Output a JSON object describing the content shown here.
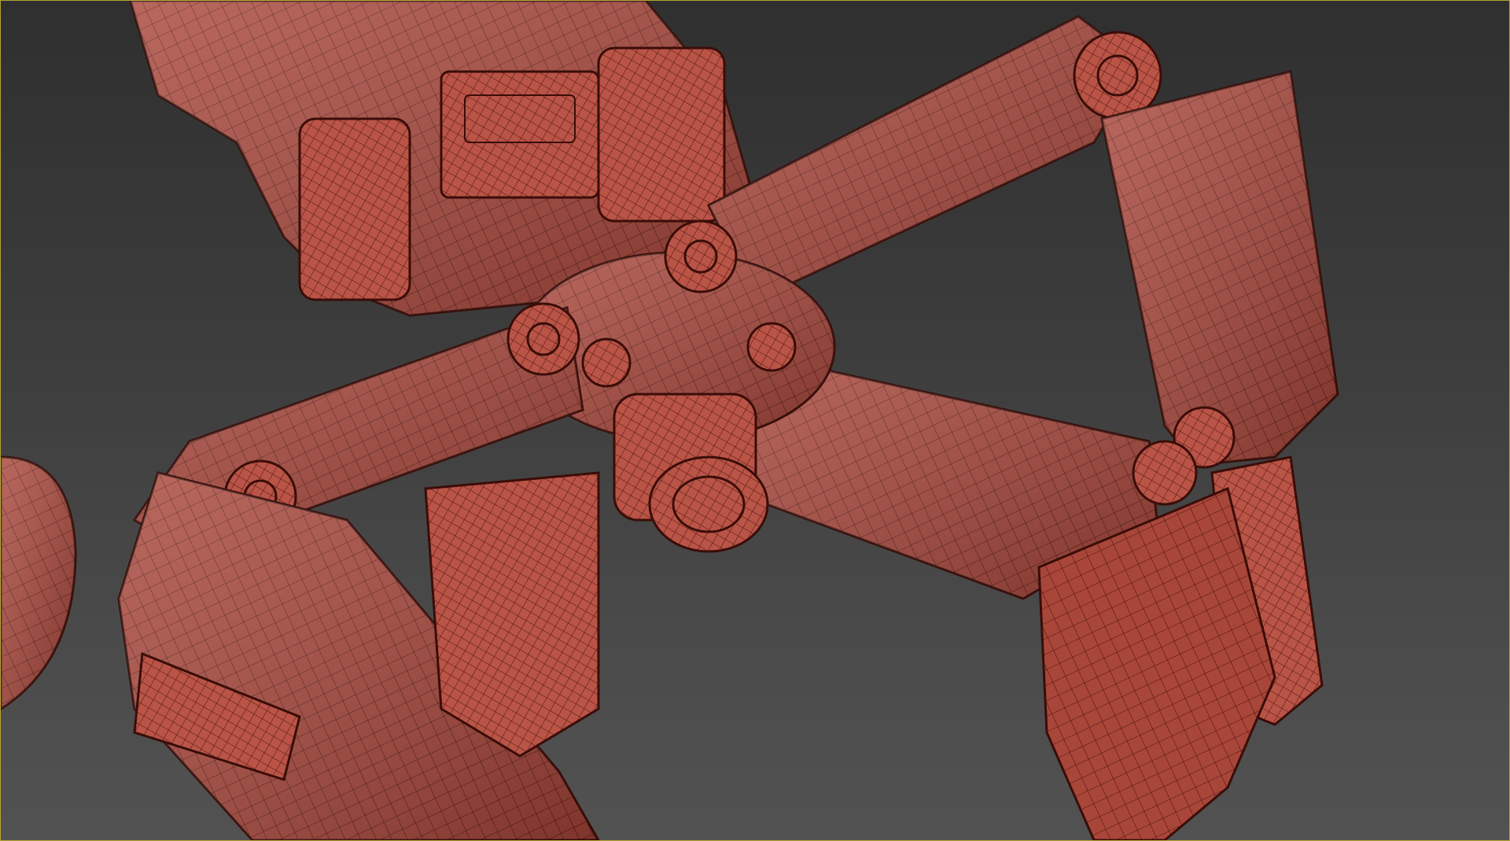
{
  "viewport": {
    "mode": "perspective-wireframe-on-shaded",
    "background_top": "#2f2f2f",
    "background_bottom": "#525252",
    "border_color": "#b6a431"
  },
  "model": {
    "material_color": "#b5483c",
    "wire_color": "#3a0d08",
    "highlight_color": "#d98477",
    "parts": [
      "upper-body",
      "central-hub",
      "back-left-leg",
      "back-right-leg",
      "front-left-leg",
      "front-right-leg",
      "offscreen-sphere"
    ]
  }
}
